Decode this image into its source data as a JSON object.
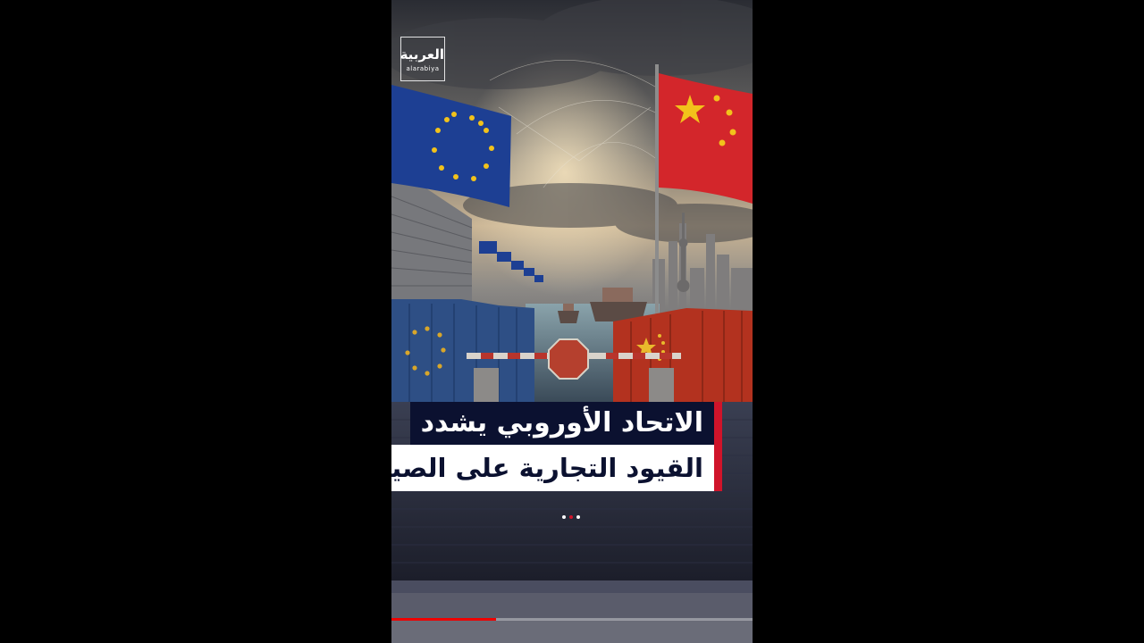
{
  "logo": {
    "arabic": "العربية",
    "latin": "alarabiya"
  },
  "headline": {
    "line1": "الاتحاد الأوروبي يشدد",
    "line2": "القيود التجارية على الصين"
  },
  "carousel": {
    "count": 3,
    "active_index": 1
  },
  "video": {
    "progress": 0.29
  },
  "colors": {
    "accent_red": "#d0142a",
    "headline_navy": "#0b1130",
    "eu_blue": "#1d3f93",
    "china_red": "#d3262b",
    "star_gold": "#f2c21b"
  },
  "icons": [
    "eu-flag-icon",
    "china-flag-icon",
    "stop-sign-icon"
  ]
}
